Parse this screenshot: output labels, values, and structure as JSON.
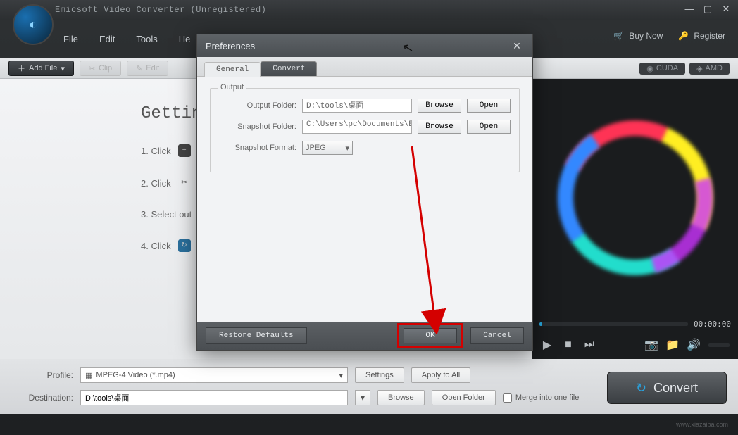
{
  "window": {
    "title": "Emicsoft Video Converter (Unregistered)"
  },
  "menu": {
    "file": "File",
    "edit": "Edit",
    "tools": "Tools",
    "help": "He"
  },
  "header_right": {
    "buy": "Buy Now",
    "register": "Register"
  },
  "toolbar": {
    "add_file": "Add File",
    "clip": "Clip",
    "edit": "Edit",
    "cuda": "CUDA",
    "amd": "AMD"
  },
  "content": {
    "heading": "Gettin",
    "steps": {
      "s1": "1. Click",
      "s2": "2. Click",
      "s3": "3. Select out",
      "s4": "4. Click"
    }
  },
  "player": {
    "time": "00:00:00"
  },
  "bottom": {
    "profile_label": "Profile:",
    "profile_value": "MPEG-4 Video (*.mp4)",
    "settings": "Settings",
    "apply_all": "Apply to All",
    "dest_label": "Destination:",
    "dest_value": "D:\\tools\\桌面",
    "browse": "Browse",
    "open_folder": "Open Folder",
    "merge": "Merge into one file",
    "convert": "Convert"
  },
  "dialog": {
    "title": "Preferences",
    "tab_general": "General",
    "tab_convert": "Convert",
    "group_output": "Output",
    "output_folder_label": "Output Folder:",
    "output_folder_value": "D:\\tools\\桌面",
    "snapshot_folder_label": "Snapshot Folder:",
    "snapshot_folder_value": "C:\\Users\\pc\\Documents\\Emic:",
    "snapshot_format_label": "Snapshot Format:",
    "snapshot_format_value": "JPEG",
    "browse": "Browse",
    "open": "Open",
    "restore": "Restore Defaults",
    "ok": "OK",
    "cancel": "Cancel"
  }
}
